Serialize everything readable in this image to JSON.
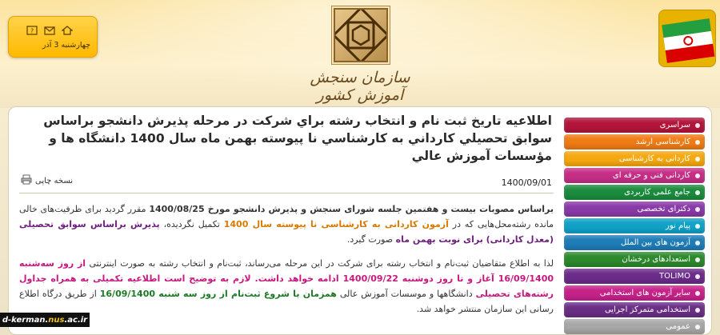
{
  "header": {
    "date": "چهارشنبه 3 آذر",
    "org_name": "سازمان سنجش آموزش کشور",
    "icons": [
      "help-icon",
      "mail-icon",
      "home-icon"
    ]
  },
  "menu": {
    "items": [
      {
        "label": "سراسری",
        "color": "#b3153a"
      },
      {
        "label": "کارشناسی ارشد",
        "color": "#f07c16"
      },
      {
        "label": "کاردانی به کارشناسی",
        "color": "#f5a810"
      },
      {
        "label": "کاردانی فنی و حرفه ای",
        "color": "#c62f86"
      },
      {
        "label": "جامع علمی کاربردی",
        "color": "#1b8c3e"
      },
      {
        "label": "دکترای تخصصی",
        "color": "#8a3aa8"
      },
      {
        "label": "پیام نور",
        "color": "#11a2c8"
      },
      {
        "label": "آزمون های بین الملل",
        "color": "#1f7db8"
      },
      {
        "label": "استعدادهای درخشان",
        "color": "#2c8a2c"
      },
      {
        "label": "TOLIMO",
        "color": "#6b2c8a"
      },
      {
        "label": "سایر آزمون های استخدامی",
        "color": "#c7228a"
      },
      {
        "label": "استخدامی متمرکز اجرایی",
        "color": "#6a2e86"
      },
      {
        "label": "عمومی",
        "color": "#a8a8a8"
      }
    ]
  },
  "article": {
    "title": "اطلاعيه تاريخ ثبت نام و انتخاب رشته براي شركت در مرحله پذيرش دانشجو براساس سوابق تحصيلي كارداني به كارشناسي نا پيوسته بهمن ماه سال 1400 دانشگاه ها و مؤسسات آموزش عالي",
    "print_label": "نسخه چاپی",
    "date": "1400/09/01",
    "p1": {
      "s1": "براساس مصوبات بیست و هفتمین جلسه شورای سنجش و پذیرش دانشجو مورخ 1400/08/25",
      "s2": " مقرر گردید برای ظرفیت‌های خالی مانده رشته‌محل‌هایی که در ",
      "s3": "آزمون کاردانی به کارشناسی نا پیوسته سال 1400",
      "s4": " تکمیل نگردیده، ",
      "s5": "پذیرش براساس سوابق تحصیلی (معدل کاردانی) برای نوبت بهمن ماه",
      "s6": " صورت گیرد."
    },
    "p2": {
      "s1": "لذا به اطلاع متقاضیان ثبت‌نام و انتخاب رشته برای شرکت در این مرحله می‌رساند، ثبت‌نام و انتخاب رشته به صورت اینترنتی ",
      "s2": "از روز سه‌شنبه 16/09/1400 آغاز و تا روز دوشنبه 1400/09/22 ادامه خواهد داشت. لازم به توضیح است اطلاعیه تکمیلی به همراه جداول رشته‌های تحصیلی",
      "s3": " دانشگاهها و موسسات آموزش عالی ",
      "s4": "همزمان با شروع ثبت‌نام از روز سه شنبه 16/09/1400",
      "s5": " از طریق درگاه اطلاع رسانی این سازمان منتشر خواهد شد."
    }
  },
  "watermark": {
    "prefix": "d-kerman.",
    "highlight": "nus",
    "suffix": ".ac.ir"
  }
}
